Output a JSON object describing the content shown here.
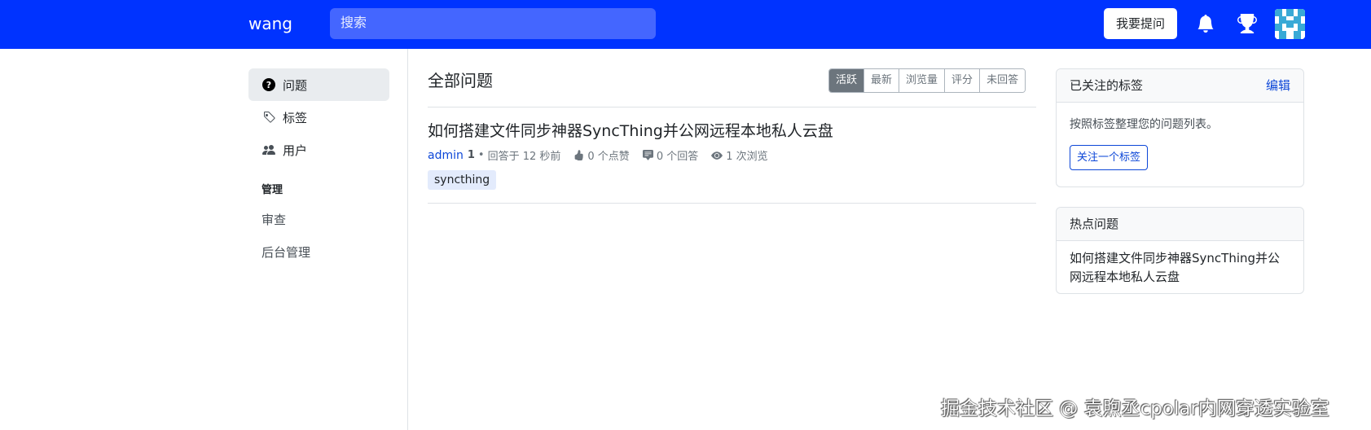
{
  "navbar": {
    "brand": "wang",
    "search_placeholder": "搜索",
    "ask_button": "我要提问",
    "icons": [
      "bell-icon",
      "trophy-icon",
      "avatar"
    ],
    "bg_color": "#0033ff"
  },
  "sidebar": {
    "items": [
      {
        "label": "问题",
        "icon": "question-circle-icon",
        "active": true
      },
      {
        "label": "标签",
        "icon": "tags-icon",
        "active": false
      },
      {
        "label": "用户",
        "icon": "people-icon",
        "active": false
      }
    ],
    "section_title": "管理",
    "admin_links": [
      "审查",
      "后台管理"
    ]
  },
  "main": {
    "title": "全部问题",
    "sort_tabs": [
      "活跃",
      "最新",
      "浏览量",
      "评分",
      "未回答"
    ],
    "active_sort": "活跃",
    "questions": [
      {
        "title": "如何搭建文件同步神器SyncThing并公网远程本地私人云盘",
        "author": "admin",
        "reputation": "1",
        "time": "回答于 12 秒前",
        "votes": "0 个点赞",
        "answers": "0 个回答",
        "views": "1 次浏览",
        "tags": [
          "syncthing"
        ]
      }
    ]
  },
  "right": {
    "followed_tags": {
      "header": "已关注的标签",
      "edit": "编辑",
      "description": "按照标签整理您的问题列表。",
      "button": "关注一个标签"
    },
    "hot_questions": {
      "header": "热点问题",
      "items": [
        "如何搭建文件同步神器SyncThing并公网远程本地私人云盘"
      ]
    }
  },
  "watermark": "掘金技术社区 @ 袁煦丞cpolar内网穿透实验室"
}
